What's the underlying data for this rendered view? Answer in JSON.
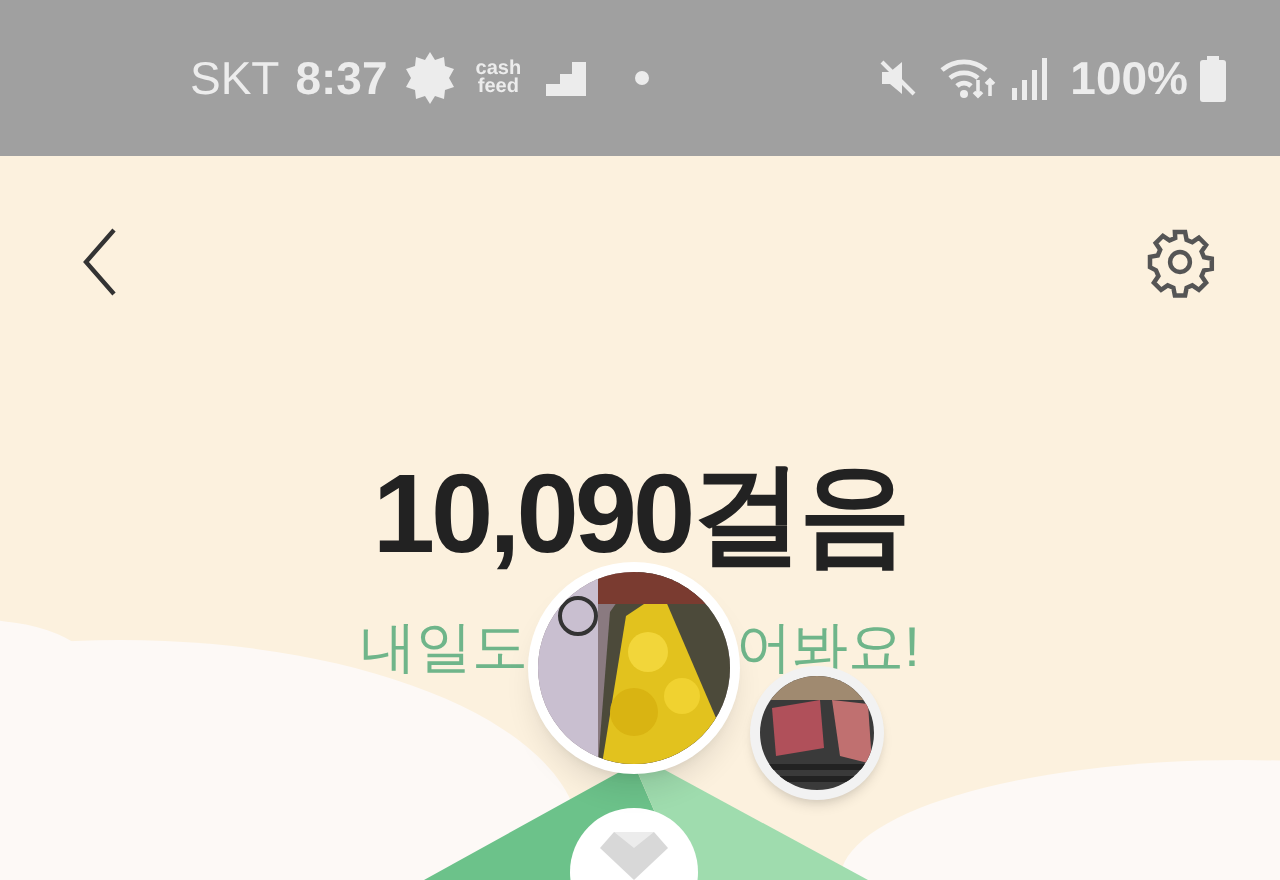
{
  "status_bar": {
    "carrier": "SKT",
    "time": "8:37",
    "app_badge_lines": [
      "cash",
      "feed"
    ],
    "battery": "100%"
  },
  "steps": "10,090걸음",
  "message_parts": [
    "내일도",
    "어봐요!"
  ]
}
